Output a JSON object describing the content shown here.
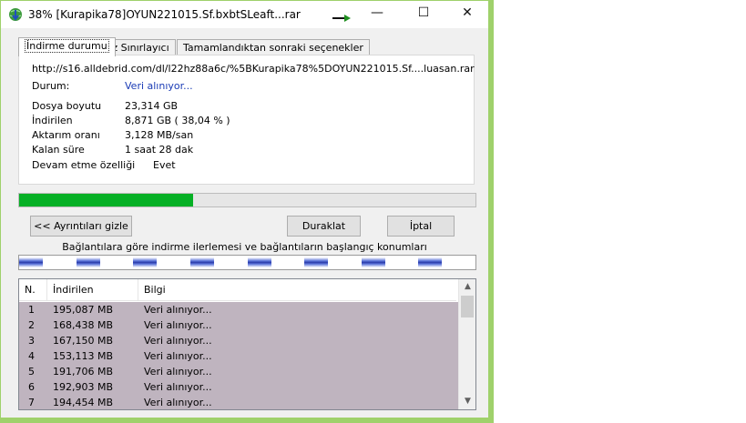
{
  "window": {
    "title": "38% [Kurapika78]OYUN221015.Sf.bxbtSLeaft...rar",
    "accent_color": "#9fd16b",
    "icon": "download-globe-icon"
  },
  "controls": {
    "minimize": "—",
    "maximize": "☐",
    "close": "✕"
  },
  "tabs": [
    {
      "label": "İndirme durumu",
      "active": true
    },
    {
      "label": "Hız Sınırlayıcı",
      "active": false
    },
    {
      "label": "Tamamlandıktan sonraki seçenekler",
      "active": false
    }
  ],
  "info": {
    "url": "http://s16.alldebrid.com/dl/l22hz88a6c/%5BKurapika78%5DOYUN221015.Sf....luasan.rar",
    "status_label": "Durum:",
    "status_value": "Veri alınıyor...",
    "file_size_label": "Dosya boyutu",
    "file_size_value": "23,314  GB",
    "downloaded_label": "İndirilen",
    "downloaded_value": "8,871  GB  ( 38,04 % )",
    "rate_label": "Aktarım oranı",
    "rate_value": "3,128  MB/san",
    "remaining_label": "Kalan süre",
    "remaining_value": "1 saat 28 dak",
    "resume_label": "Devam etme özelliği",
    "resume_value": "Evet"
  },
  "progress": {
    "fraction": 0.3804,
    "color": "#06b025"
  },
  "buttons": {
    "details": "<< Ayrıntıları gizle",
    "pause": "Duraklat",
    "cancel": "İptal"
  },
  "connections": {
    "caption": "Bağlantılara göre indirme ilerlemesi ve bağlantıların başlangıç konumları",
    "segment_count": 8
  },
  "list": {
    "headers": {
      "n": "N.",
      "downloaded": "İndirilen",
      "info": "Bilgi"
    },
    "rows": [
      {
        "n": "1",
        "downloaded": "195,087  MB",
        "info": "Veri alınıyor..."
      },
      {
        "n": "2",
        "downloaded": "168,438  MB",
        "info": "Veri alınıyor..."
      },
      {
        "n": "3",
        "downloaded": "167,150  MB",
        "info": "Veri alınıyor..."
      },
      {
        "n": "4",
        "downloaded": "153,113  MB",
        "info": "Veri alınıyor..."
      },
      {
        "n": "5",
        "downloaded": "191,706  MB",
        "info": "Veri alınıyor..."
      },
      {
        "n": "6",
        "downloaded": "192,903  MB",
        "info": "Veri alınıyor..."
      },
      {
        "n": "7",
        "downloaded": "194,454  MB",
        "info": "Veri alınıyor..."
      }
    ],
    "row_color": "#bfb4bf"
  }
}
